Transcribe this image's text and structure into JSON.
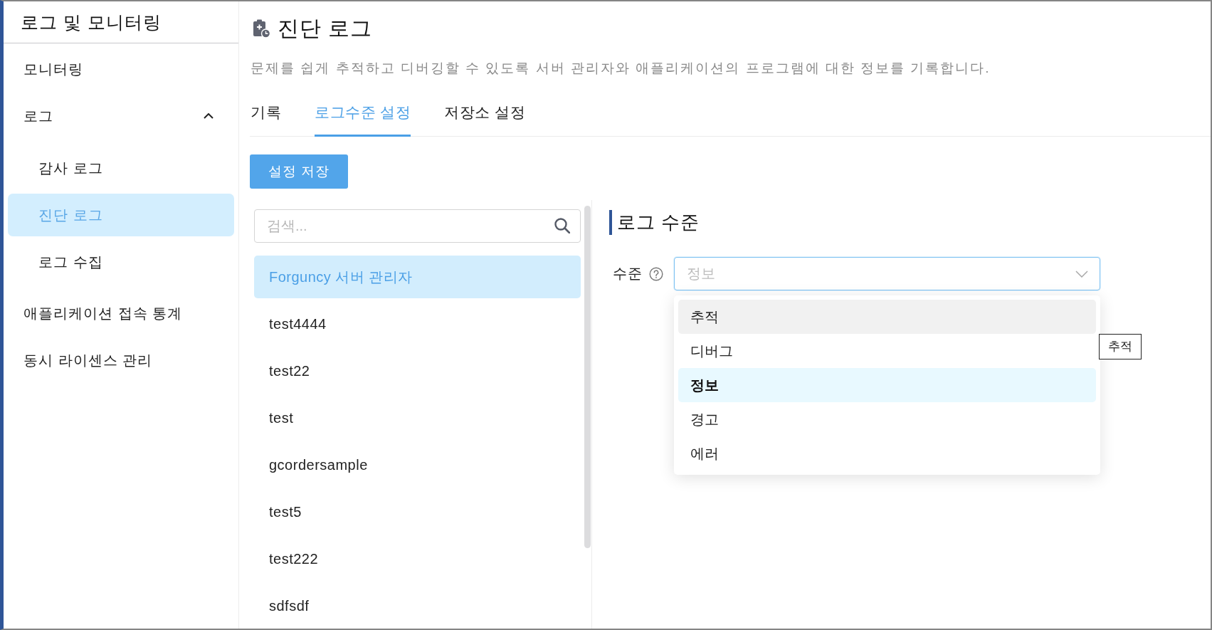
{
  "sidebar": {
    "title": "로그 및 모니터링",
    "items": [
      {
        "label": "모니터링",
        "selected": false
      },
      {
        "label": "로그",
        "selected": false,
        "expanded": true,
        "children": [
          {
            "label": "감사 로그",
            "selected": false
          },
          {
            "label": "진단 로그",
            "selected": true
          },
          {
            "label": "로그 수집",
            "selected": false
          }
        ]
      },
      {
        "label": "애플리케이션 접속 통계",
        "selected": false
      },
      {
        "label": "동시 라이센스 관리",
        "selected": false
      }
    ]
  },
  "page": {
    "title": "진단 로그",
    "description": "문제를 쉽게 추적하고 디버깅할 수 있도록 서버 관리자와 애플리케이션의 프로그램에 대한 정보를 기록합니다."
  },
  "tabs": [
    {
      "label": "기록",
      "selected": false
    },
    {
      "label": "로그수준 설정",
      "selected": true
    },
    {
      "label": "저장소 설정",
      "selected": false
    }
  ],
  "save_button": {
    "label": "설정 저장"
  },
  "app_list": {
    "search": {
      "placeholder": "검색..."
    },
    "items": [
      {
        "label": "Forguncy 서버 관리자",
        "selected": true
      },
      {
        "label": "test4444",
        "selected": false
      },
      {
        "label": "test22",
        "selected": false
      },
      {
        "label": "test",
        "selected": false
      },
      {
        "label": "gcordersample",
        "selected": false
      },
      {
        "label": "test5",
        "selected": false
      },
      {
        "label": "test222",
        "selected": false
      },
      {
        "label": "sdfsdf",
        "selected": false
      }
    ]
  },
  "log_level": {
    "heading": "로그 수준",
    "field": {
      "label": "수준",
      "value": "정보",
      "open": true
    },
    "options": [
      {
        "label": "추적",
        "selected": false,
        "hovered": true
      },
      {
        "label": "디버그",
        "selected": false,
        "hovered": false
      },
      {
        "label": "정보",
        "selected": true,
        "hovered": false
      },
      {
        "label": "경고",
        "selected": false,
        "hovered": false
      },
      {
        "label": "에러",
        "selected": false,
        "hovered": false
      }
    ],
    "tooltip": {
      "text": "추적"
    }
  }
}
